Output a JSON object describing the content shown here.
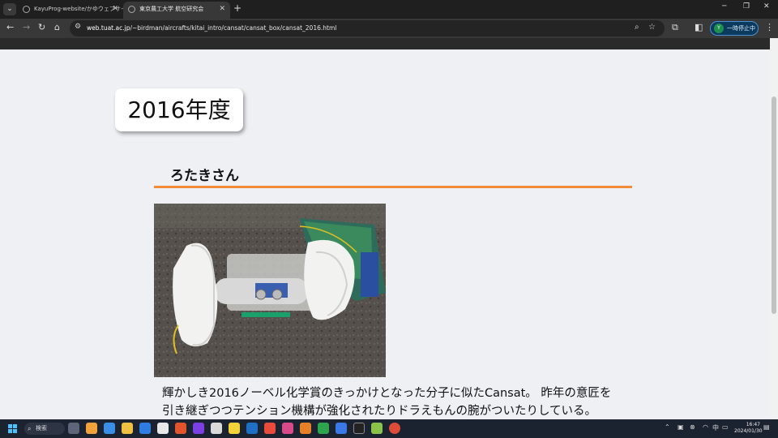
{
  "browser": {
    "tabs": [
      {
        "title": "KayuProg-website/かゆウェブサイ…"
      },
      {
        "title": "東京農工大学 航空研究会"
      }
    ],
    "new_tab": "+",
    "url_host": "web.tuat.ac.jp",
    "url_path": "/~birdman/aircrafts/kitai_intro/cansat/cansat_box/cansat_2016.html",
    "profile_initial": "Y",
    "profile_status": "一時停止中"
  },
  "page": {
    "year_title": "2016年度",
    "section_heading": "ろたきさん",
    "description": "輝かしき2016ノーベル化学賞のきっかけとなった分子に似たCansat。 昨年の意匠を引き継ぎつつテンション機構が強化されたりドラえもんの腕がついたりしている。",
    "accent_color": "#f28c38"
  },
  "taskbar": {
    "search_label": "検索",
    "time": "16:47",
    "date": "2024/01/30"
  }
}
